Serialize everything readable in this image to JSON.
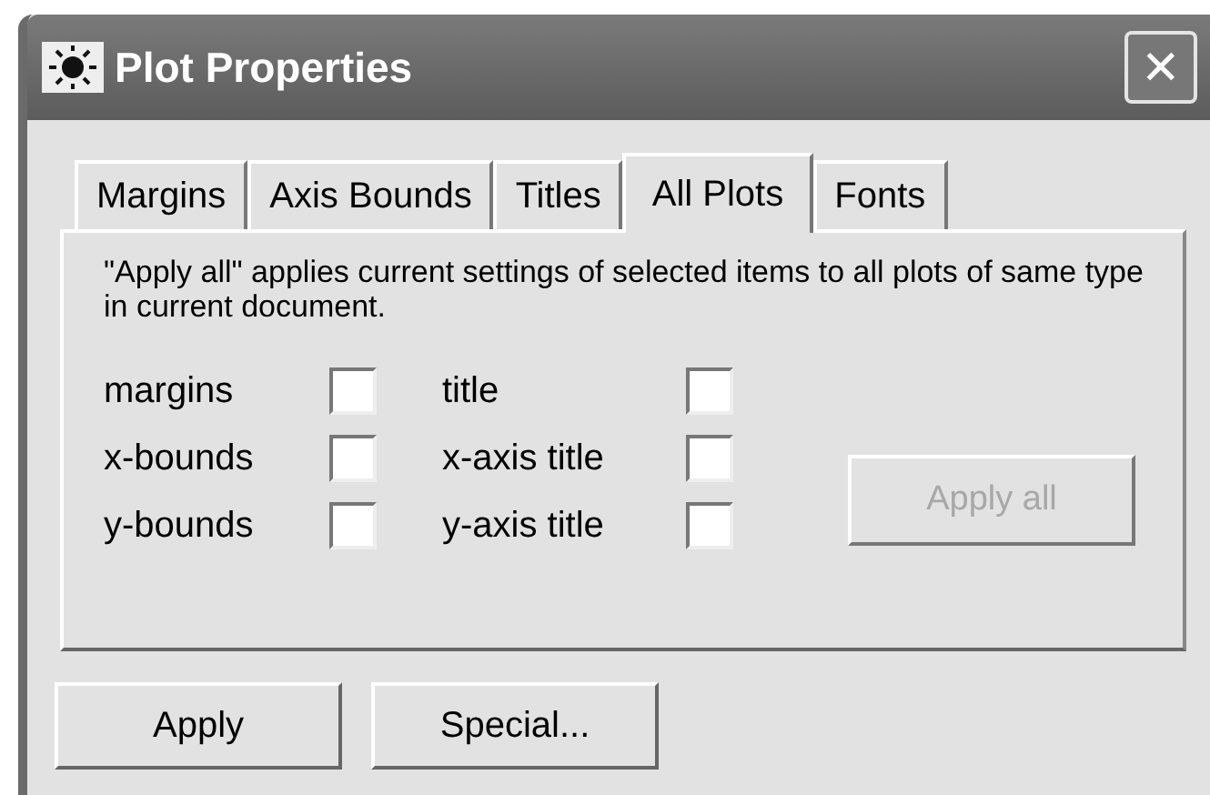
{
  "window": {
    "title": "Plot Properties",
    "close": "✕"
  },
  "tabs": [
    {
      "label": "Margins",
      "selected": false
    },
    {
      "label": "Axis Bounds",
      "selected": false
    },
    {
      "label": "Titles",
      "selected": false
    },
    {
      "label": "All Plots",
      "selected": true
    },
    {
      "label": "Fonts",
      "selected": false
    }
  ],
  "description": "\"Apply all\" applies current settings of selected items to all plots of same type in current document.",
  "option_columns": [
    [
      {
        "label": "margins",
        "checked": false
      },
      {
        "label": "x-bounds",
        "checked": false
      },
      {
        "label": "y-bounds",
        "checked": false
      }
    ],
    [
      {
        "label": "title",
        "checked": false
      },
      {
        "label": "x-axis title",
        "checked": false
      },
      {
        "label": "y-axis title",
        "checked": false
      }
    ]
  ],
  "apply_all_button": {
    "label": "Apply all",
    "disabled": true
  },
  "buttons": [
    {
      "label": "Apply"
    },
    {
      "label": "Special..."
    }
  ]
}
